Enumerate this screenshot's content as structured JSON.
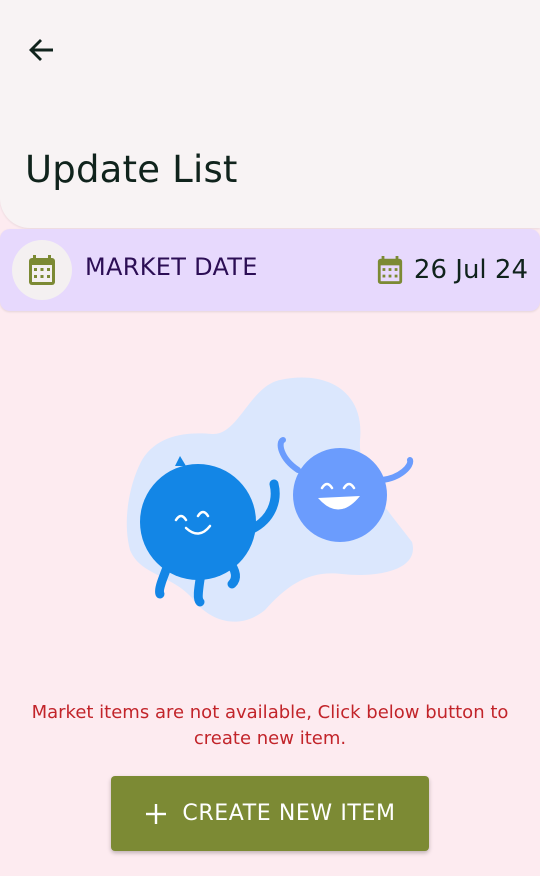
{
  "header": {
    "title": "Update List",
    "back_icon": "arrow-left-icon"
  },
  "date_bar": {
    "label": "MARKET DATE",
    "value": "26 Jul 24",
    "icon": "calendar-icon",
    "background": "#e7d9fd",
    "icon_color": "#7c8a34"
  },
  "empty_state": {
    "message": "Market items are not available, Click below button to create new item.",
    "message_color": "#c2242a",
    "illustration": "two-happy-characters"
  },
  "create_button": {
    "label": "CREATE NEW ITEM",
    "icon": "plus-icon",
    "color": "#7c8a34"
  },
  "colors": {
    "page_background": "#fdebf0",
    "header_background": "#f8f3f4"
  }
}
